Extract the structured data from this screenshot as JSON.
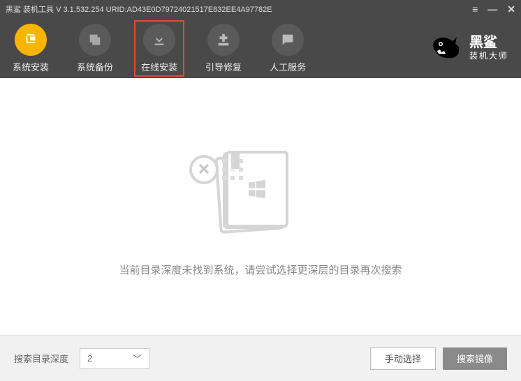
{
  "titlebar": {
    "text": "黑鲨 装机工具 V 3.1.532.254 URID:AD43E0D79724021517E832EE4A97782E"
  },
  "toolbar": {
    "items": [
      {
        "label": "系统安装",
        "active": true
      },
      {
        "label": "系统备份",
        "active": false
      },
      {
        "label": "在线安装",
        "active": false,
        "highlighted": true
      },
      {
        "label": "引导修复",
        "active": false
      },
      {
        "label": "人工服务",
        "active": false
      }
    ]
  },
  "brand": {
    "main": "黑鲨",
    "sub": "装机大师"
  },
  "main": {
    "empty_message": "当前目录深度未找到系统，请尝试选择更深层的目录再次搜索"
  },
  "footer": {
    "depth_label": "搜索目录深度",
    "depth_value": "2",
    "manual_button": "手动选择",
    "search_button": "搜索镜像"
  }
}
